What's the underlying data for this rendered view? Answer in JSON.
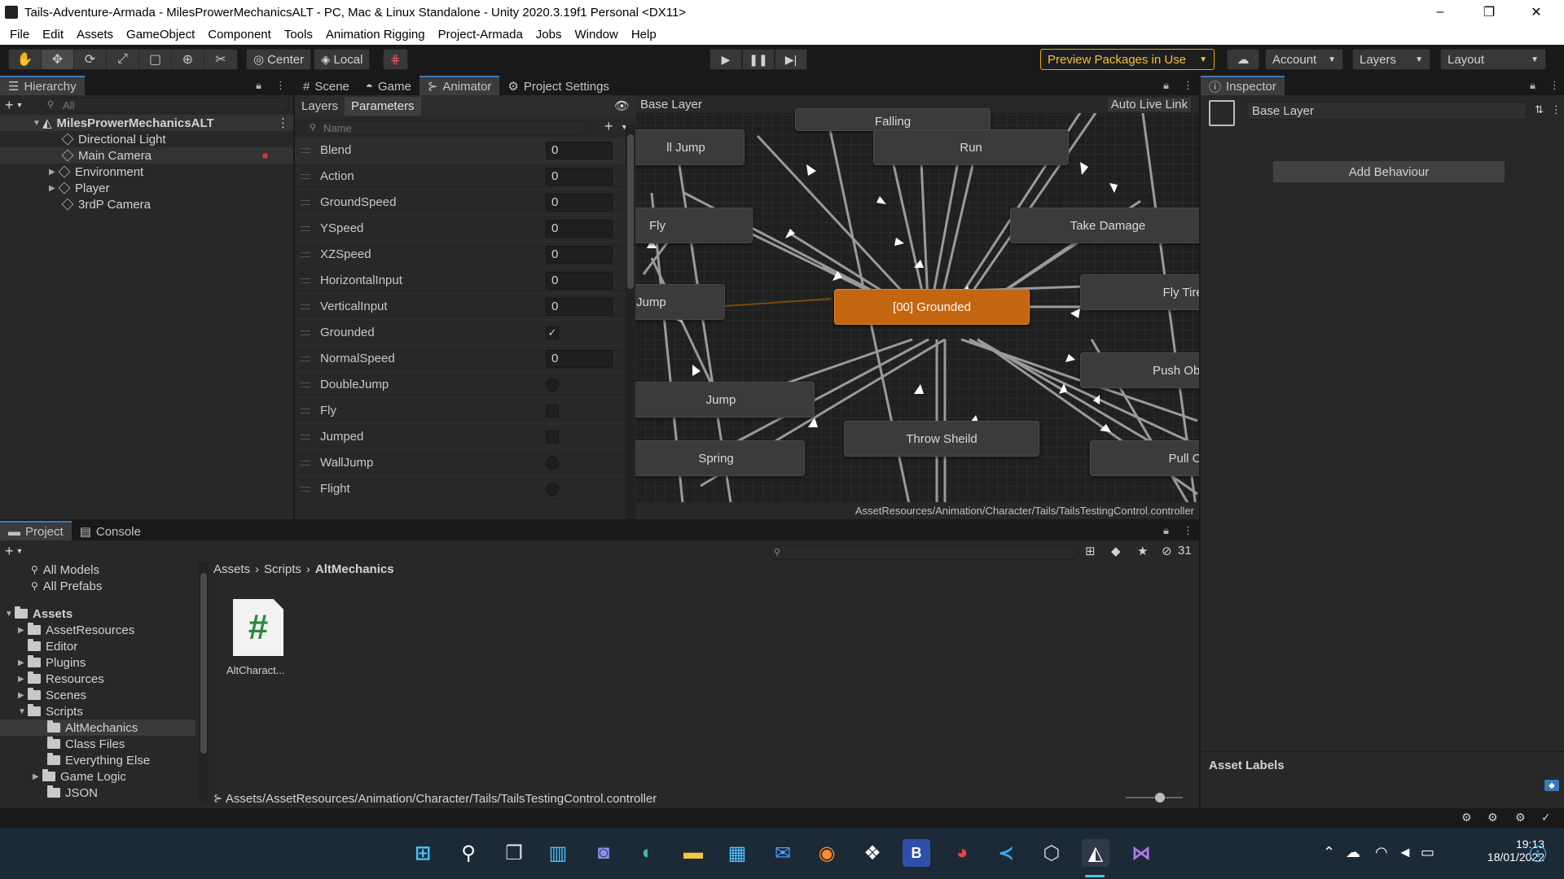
{
  "window": {
    "title": "Tails-Adventure-Armada - MilesProwerMechanicsALT - PC, Mac & Linux Standalone - Unity 2020.3.19f1 Personal <DX11>",
    "minimize": "–",
    "restore": "❐",
    "close": "✕"
  },
  "menubar": [
    "File",
    "Edit",
    "Assets",
    "GameObject",
    "Component",
    "Tools",
    "Animation Rigging",
    "Project-Armada",
    "Jobs",
    "Window",
    "Help"
  ],
  "toolbar": {
    "tools": [
      "hand-icon",
      "move-icon",
      "rotate-icon",
      "scale-icon",
      "rect-icon",
      "transform-icon",
      "custom-tool-icon"
    ],
    "pivot": "Center",
    "space": "Local",
    "preview_packages": "Preview Packages in Use",
    "account": "Account",
    "layers": "Layers",
    "layout": "Layout"
  },
  "hierarchy": {
    "tab": "Hierarchy",
    "search_placeholder": "All",
    "scene": "MilesProwerMechanicsALT",
    "items": [
      {
        "label": "Directional Light"
      },
      {
        "label": "Main Camera"
      },
      {
        "label": "Environment"
      },
      {
        "label": "Player"
      },
      {
        "label": "3rdP Camera"
      }
    ]
  },
  "center_tabs": [
    "Scene",
    "Game",
    "Animator",
    "Project Settings"
  ],
  "animator": {
    "subtabs": [
      "Layers",
      "Parameters"
    ],
    "name_placeholder": "Name",
    "breadcrumb": "Base Layer",
    "auto_live_link": "Auto Live Link",
    "controller_path": "AssetResources/Animation/Character/Tails/TailsTestingControl.controller",
    "params": [
      {
        "name": "Blend",
        "value": "0"
      },
      {
        "name": "Action",
        "value": "0"
      },
      {
        "name": "GroundSpeed",
        "value": "0"
      },
      {
        "name": "YSpeed",
        "value": "0"
      },
      {
        "name": "XZSpeed",
        "value": "0"
      },
      {
        "name": "HorizontalInput",
        "value": "0"
      },
      {
        "name": "VerticalInput",
        "value": "0"
      },
      {
        "name": "Grounded",
        "value": "✓"
      },
      {
        "name": "NormalSpeed",
        "value": "0"
      },
      {
        "name": "DoubleJump"
      },
      {
        "name": "Fly"
      },
      {
        "name": "Jumped"
      },
      {
        "name": "WallJump"
      },
      {
        "name": "Flight"
      }
    ],
    "states": {
      "falling": "Falling",
      "wall_jump": "ll Jump",
      "run": "Run",
      "fly": "Fly",
      "take_damage": "Take Damage",
      "fly_tired": "Fly Tired",
      "jump_partial": "Jump",
      "grounded": "[00] Grounded",
      "push": "Push Obje",
      "jump": "Jump",
      "throw": "Throw Sheild",
      "spring": "Spring",
      "pull": "Pull Obj"
    }
  },
  "inspector": {
    "tab": "Inspector",
    "layer_name": "Base Layer",
    "add_behaviour": "Add Behaviour",
    "asset_labels": "Asset Labels"
  },
  "project": {
    "tabs": [
      "Project",
      "Console"
    ],
    "hidden_count": "31",
    "breadcrumb": [
      "Assets",
      "Scripts",
      "AltMechanics"
    ],
    "favorites": [
      "All Models",
      "All Prefabs"
    ],
    "assets_root": "Assets",
    "folders": [
      "AssetResources",
      "Editor",
      "Plugins",
      "Resources",
      "Scenes",
      "Scripts"
    ],
    "script_folders": [
      "AltMechanics",
      "Class Files",
      "Everything Else",
      "Game Logic",
      "JSON"
    ],
    "asset_name": "AltCharact...",
    "asset_glyph": "#",
    "path": "Assets/AssetResources/Animation/Character/Tails/TailsTestingControl.controller"
  },
  "taskbar": {
    "time": "19:13",
    "date": "18/01/2022",
    "notification_count": "1"
  }
}
